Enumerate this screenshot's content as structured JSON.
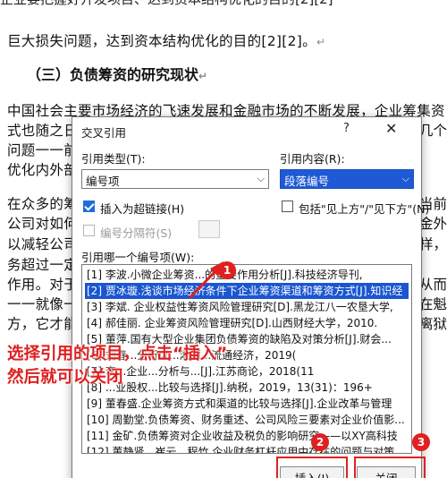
{
  "document": {
    "cut_top_line": "企业要把握好开发项目、达到资本结构优化的目的[2][2]",
    "line1": "巨大损失问题，达到资本结构优化的目的[2][2]。",
    "heading": "（三）负债筹资的研究现状",
    "lines_left": [
      "中国社会主要市场经济的飞速发展和金融市场的不断发展，企业筹集资",
      "式也随之日",
      "问题一一前",
      "优化内外部",
      "在众多的筹",
      "公司对如何",
      "以减轻公司",
      "务超过一定",
      "作用。对于",
      "一一就像一",
      "方，它才能"
    ],
    "lines_right": [
      "几个",
      "当前",
      "金外",
      "样，",
      "从而",
      "在魁",
      "离狱"
    ]
  },
  "dialog": {
    "title": "交叉引用",
    "help": "?",
    "close": "✕",
    "ref_type_label": "引用类型(T):",
    "ref_type_value": "编号项",
    "ref_content_label": "引用内容(R):",
    "ref_content_value": "段落编号",
    "insert_hyperlink_label": "插入为超链接(H)",
    "include_above_below_label": "包括\"见上方\"/\"见下方\"(N)",
    "separator_label": "编号分隔符(S)",
    "list_label": "引用哪一个编号项(W):",
    "items": [
      "[1] 李波.小微企业筹资...的重要作用分析[J].科技经济导刊,",
      "[2] 贾冰璇.浅谈市场经济条件下企业筹资渠道和筹资方式[J].知识经",
      "[3] 李斌. 企业权益性筹资风险管理研究[D].黑龙江八一农垦大学,",
      "[4] 郝佳丽. 企业筹资风险管理研究[D].山西财经大学，2010.",
      "[5] 董萍.国有大型企业集团负债筹资的缺陷及对策分析[J].财会...",
      "[6] 刘春...分析以...湘潭...流通经济，2019(",
      "[7] 李...企业...分析与...[J].江苏商论，2018(11",
      "[8] ...业股权...比较与选择[J].纳税，2019，13(31)：196+",
      "[9] 董春盛.企业筹资方式和渠道的比较与选择[J].企业改革与管理",
      "[10] 周勤堂.负债筹资、财务重述、公司风险三要素对企业价值影...",
      "[11] 金矿.负债筹资对企业收益及税负的影响研究——以XY高科技",
      "[12] 董静贤，崔云，程竹.企业财务杠杆应用中存在的问题与对策..."
    ],
    "selected_index": 1,
    "insert_button": "插入(I)",
    "cancel_button": "关闭"
  },
  "annotation": {
    "text_line1": "选择引用的项目，点击“插入”",
    "text_line2": "然后就可以关闭",
    "badge1": "1",
    "badge2": "2",
    "badge3": "3"
  },
  "colors": {
    "accent": "#e02020",
    "selection": "#1b56d0"
  }
}
